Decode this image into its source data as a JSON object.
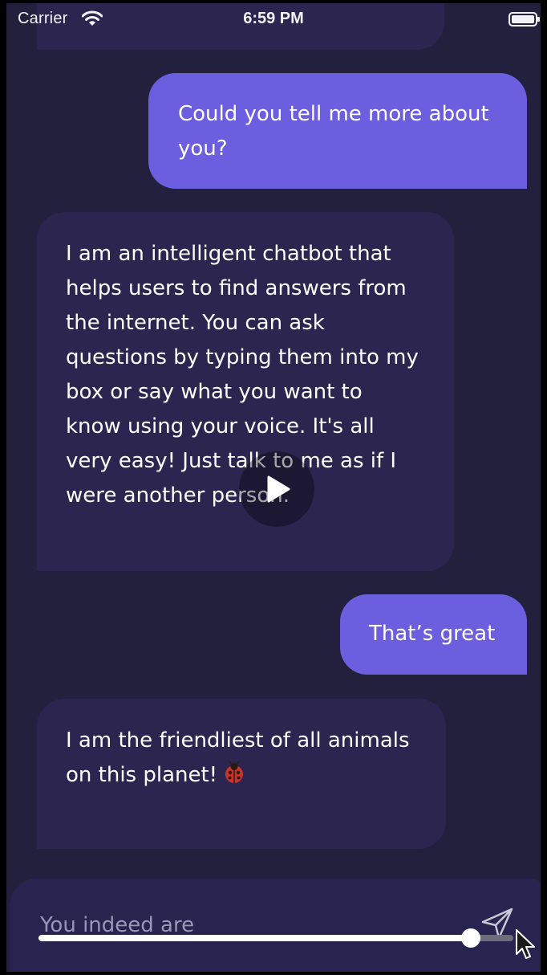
{
  "status_bar": {
    "carrier": "Carrier",
    "time": "6:59 PM",
    "icons": [
      "wifi-icon",
      "battery-icon"
    ]
  },
  "messages": [
    {
      "sender": "bot",
      "text": ""
    },
    {
      "sender": "user",
      "text": "Could you tell me more about\nyou?"
    },
    {
      "sender": "bot",
      "text": "I am an intelligent chatbot that\nhelps users to find answers from\nthe internet. You can ask\nquestions by typing them into my\nbox or say what you want to\nknow using your voice. It's all\nvery easy! Just talk to me as if I\nwere another person."
    },
    {
      "sender": "user",
      "text": "That’s great"
    },
    {
      "sender": "bot",
      "text": "I am the friendliest of all animals\non this planet!",
      "emoji_icon": "ladybug-icon"
    }
  ],
  "input": {
    "value": "",
    "placeholder": "You indeed are",
    "send_icon": "send-icon"
  },
  "video_overlay": {
    "play_icon": "play-icon",
    "progress_fraction": 0.91
  },
  "colors": {
    "background": "#22203c",
    "bot_bubble": "#2b2550",
    "user_bubble": "#6b5fe0",
    "input_bar": "#282450",
    "placeholder": "#9a97b6"
  }
}
